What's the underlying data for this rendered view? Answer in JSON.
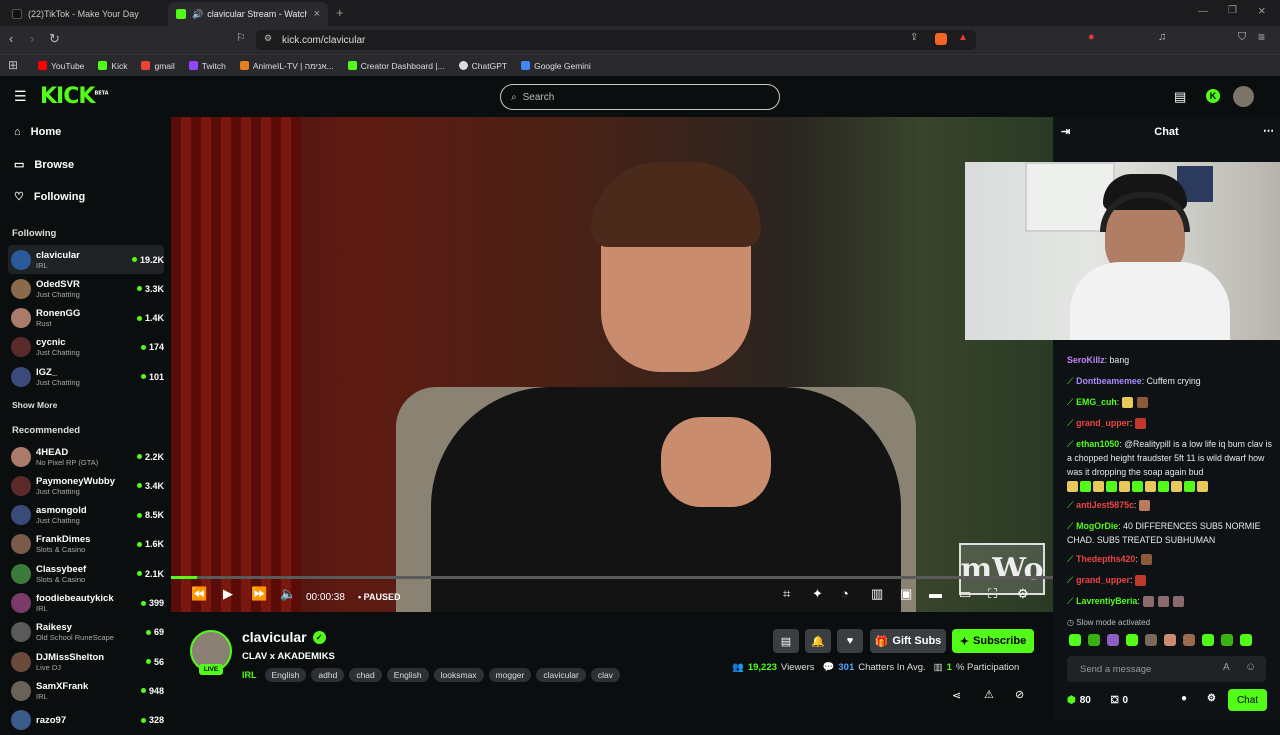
{
  "browser": {
    "tabs": [
      {
        "title": "(22)TikTok - Make Your Day",
        "active": false
      },
      {
        "title": "clavicular Stream - Watch Live...",
        "active": true
      }
    ],
    "url": "kick.com/clavicular",
    "bookmarks": [
      "YouTube",
      "Kick",
      "gmail",
      "Twitch",
      "AnimeIL-TV | אנימה...",
      "Creator Dashboard |...",
      "ChatGPT",
      "Google Gemini"
    ]
  },
  "header": {
    "logo": "KICK",
    "logo_badge": "BETA",
    "search_placeholder": "Search"
  },
  "sidebar": {
    "nav": [
      {
        "label": "Home",
        "icon": "home-icon"
      },
      {
        "label": "Browse",
        "icon": "browse-icon"
      },
      {
        "label": "Following",
        "icon": "heart-icon"
      }
    ],
    "following_title": "Following",
    "following": [
      {
        "name": "clavicular",
        "category": "IRL",
        "viewers": "19.2K"
      },
      {
        "name": "OdedSVR",
        "category": "Just Chatting",
        "viewers": "3.3K"
      },
      {
        "name": "RonenGG",
        "category": "Rust",
        "viewers": "1.4K"
      },
      {
        "name": "cycnic",
        "category": "Just Chatting",
        "viewers": "174"
      },
      {
        "name": "IGZ_",
        "category": "Just Chatting",
        "viewers": "101"
      }
    ],
    "show_more": "Show More",
    "recommended_title": "Recommended",
    "recommended": [
      {
        "name": "4HEAD",
        "category": "No Pixel RP (GTA)",
        "viewers": "2.2K"
      },
      {
        "name": "PaymoneyWubby",
        "category": "Just Chatting",
        "viewers": "3.4K"
      },
      {
        "name": "asmongold",
        "category": "Just Chatting",
        "viewers": "8.5K"
      },
      {
        "name": "FrankDimes",
        "category": "Slots & Casino",
        "viewers": "1.6K"
      },
      {
        "name": "Classybeef",
        "category": "Slots & Casino",
        "viewers": "2.1K"
      },
      {
        "name": "foodiebeautykick",
        "category": "IRL",
        "viewers": "399"
      },
      {
        "name": "Raikesy",
        "category": "Old School RuneScape",
        "viewers": "69"
      },
      {
        "name": "DJMissShelton",
        "category": "Live DJ",
        "viewers": "56"
      },
      {
        "name": "SamXFrank",
        "category": "IRL",
        "viewers": "948"
      },
      {
        "name": "razo97",
        "category": "",
        "viewers": "328"
      }
    ]
  },
  "player": {
    "time": "00:00:38",
    "state": "PAUSED",
    "progress": 0.03,
    "watermark": "mWo"
  },
  "channel": {
    "name": "clavicular",
    "live_label": "LIVE",
    "title": "CLAV x AKADEMIKS",
    "category": "IRL",
    "tags": [
      "English",
      "adhd",
      "chad",
      "English",
      "looksmax",
      "mogger",
      "clavicular",
      "clav"
    ],
    "gift_subs": "Gift Subs",
    "subscribe": "Subscribe",
    "viewers": "19,223",
    "viewers_label": "Viewers",
    "chatters": "301",
    "chatters_label": "Chatters In Avg.",
    "participation": "1",
    "participation_label": "% Participation"
  },
  "chat": {
    "title": "Chat",
    "messages": [
      {
        "user": "SeroKillz",
        "color": "#c084fc",
        "text": ": bang"
      },
      {
        "user": "Dontbeamemee",
        "color": "#a78bfa",
        "text": ": Cuffem crying"
      },
      {
        "user": "EMG_cuh",
        "color": "#53fc18",
        "text": ":"
      },
      {
        "user": "grand_upper",
        "color": "#ef4444",
        "text": ":"
      },
      {
        "user": "ethan1050",
        "color": "#53fc18",
        "text": ": @Realitypill is a low life iq bum clav is a chopped height fraudster 5ft 11 is wild dwarf how was it dropping the soap again bud"
      },
      {
        "user": "antiJest5875c",
        "color": "#ef4444",
        "text": ":"
      },
      {
        "user": "MogOrDie",
        "color": "#53fc18",
        "text": ": 40 DIFFERENCES SUB5 NORMIE CHAD. SUB5 TREATED SUBHUMAN"
      },
      {
        "user": "Thedepths420",
        "color": "#ef4444",
        "text": ":"
      },
      {
        "user": "grand_upper",
        "color": "#ef4444",
        "text": ":"
      },
      {
        "user": "LavrentiyBeria",
        "color": "#53fc18",
        "text": ":"
      }
    ],
    "slow_mode": "Slow mode activated",
    "input_placeholder": "Send a message",
    "points": "80",
    "gifts": "0",
    "chat_button": "Chat"
  },
  "colors": {
    "accent": "#53fc18",
    "bg": "#0b0e0f"
  }
}
